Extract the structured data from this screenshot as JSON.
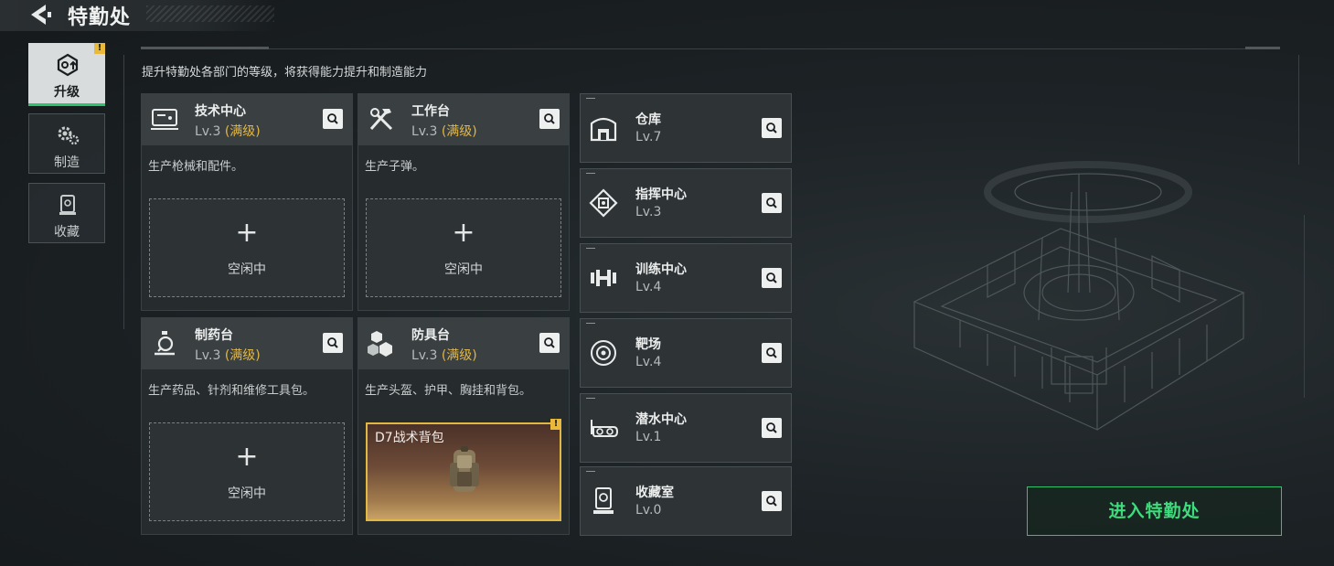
{
  "header": {
    "title": "特勤处",
    "back_icon": "back-arrow-icon"
  },
  "subtitle": "提升特勤处各部门的等级，将获得能力提升和制造能力",
  "sidebar": {
    "badge": "!",
    "tabs": [
      {
        "label": "升级",
        "icon": "upgrade-icon",
        "active": true
      },
      {
        "label": "制造",
        "icon": "gears-icon",
        "active": false
      },
      {
        "label": "收藏",
        "icon": "collection-icon",
        "active": false
      }
    ]
  },
  "workshops": [
    {
      "name": "技术中心",
      "level": "Lv.3",
      "status": "(满级)",
      "desc": "生产枪械和配件。",
      "icon": "tech-center-icon",
      "slot": {
        "plus": "+",
        "label": "空闲中"
      }
    },
    {
      "name": "工作台",
      "level": "Lv.3",
      "status": "(满级)",
      "desc": "生产子弹。",
      "icon": "workbench-icon",
      "slot": {
        "plus": "+",
        "label": "空闲中"
      }
    },
    {
      "name": "制药台",
      "level": "Lv.3",
      "status": "(满级)",
      "desc": "生产药品、针剂和维修工具包。",
      "icon": "pharmacy-icon",
      "slot": {
        "plus": "+",
        "label": "空闲中"
      }
    },
    {
      "name": "防具台",
      "level": "Lv.3",
      "status": "(满级)",
      "desc": "生产头盔、护甲、胸挂和背包。",
      "icon": "armor-bench-icon",
      "item": {
        "name": "D7战术背包",
        "badge": "!",
        "icon": "backpack-icon"
      }
    }
  ],
  "facilities": [
    {
      "name": "仓库",
      "level": "Lv.7",
      "icon": "warehouse-icon"
    },
    {
      "name": "指挥中心",
      "level": "Lv.3",
      "icon": "command-center-icon"
    },
    {
      "name": "训练中心",
      "level": "Lv.4",
      "icon": "training-center-icon"
    },
    {
      "name": "靶场",
      "level": "Lv.4",
      "icon": "shooting-range-icon"
    },
    {
      "name": "潜水中心",
      "level": "Lv.1",
      "icon": "diving-center-icon"
    },
    {
      "name": "收藏室",
      "level": "Lv.0",
      "icon": "collection-room-icon"
    }
  ],
  "enter_button": "进入特勤处",
  "colors": {
    "accent_green": "#2fc46c",
    "max_level_gold": "#e2b845",
    "badge_yellow": "#e8b93a"
  }
}
